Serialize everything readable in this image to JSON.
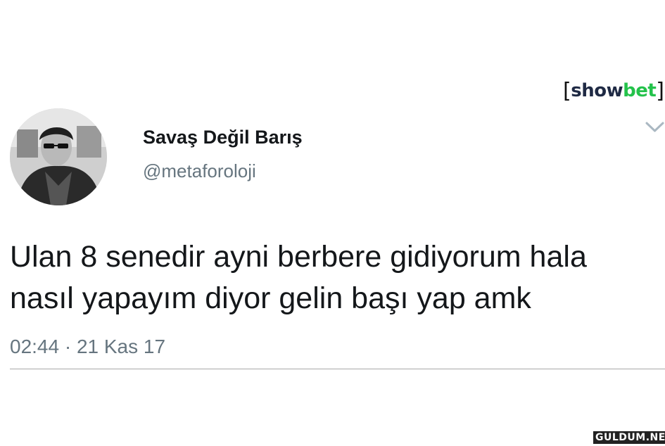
{
  "tweet": {
    "display_name": "Savaş Değil Barış",
    "handle": "@metaforoloji",
    "text_lines": [
      "Ulan 8 senedir ayni berbere gidiyorum hala",
      "nasıl yapayım diyor gelin başı yap amk"
    ],
    "timestamp": "02:44 · 21 Kas 17"
  },
  "icons": {
    "avatar": "profile-photo",
    "menu": "chevron-down-icon"
  },
  "branding": {
    "logo_text": "showbet",
    "logo_part_1": "show",
    "logo_part_2": "bet",
    "logo_color_1": "#1f2a44",
    "logo_color_2": "#24c24b",
    "watermark_text": "GULDUM.NET"
  },
  "colors": {
    "text_primary": "#14171a",
    "text_secondary": "#66757f",
    "divider": "#a9a9a9"
  }
}
